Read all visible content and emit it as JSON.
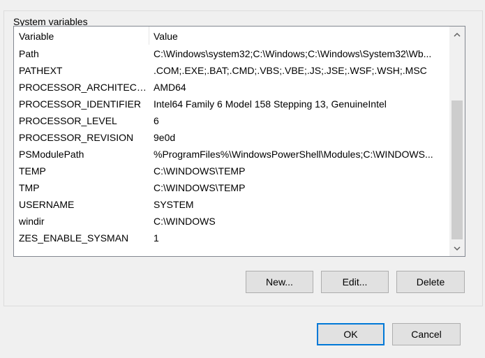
{
  "group": {
    "title": "System variables"
  },
  "table": {
    "columns": [
      "Variable",
      "Value"
    ],
    "rows": [
      {
        "variable": "Path",
        "value": "C:\\Windows\\system32;C:\\Windows;C:\\Windows\\System32\\Wb..."
      },
      {
        "variable": "PATHEXT",
        "value": ".COM;.EXE;.BAT;.CMD;.VBS;.VBE;.JS;.JSE;.WSF;.WSH;.MSC"
      },
      {
        "variable": "PROCESSOR_ARCHITECTU...",
        "value": "AMD64"
      },
      {
        "variable": "PROCESSOR_IDENTIFIER",
        "value": "Intel64 Family 6 Model 158 Stepping 13, GenuineIntel"
      },
      {
        "variable": "PROCESSOR_LEVEL",
        "value": "6"
      },
      {
        "variable": "PROCESSOR_REVISION",
        "value": "9e0d"
      },
      {
        "variable": "PSModulePath",
        "value": "%ProgramFiles%\\WindowsPowerShell\\Modules;C:\\WINDOWS..."
      },
      {
        "variable": "TEMP",
        "value": "C:\\WINDOWS\\TEMP"
      },
      {
        "variable": "TMP",
        "value": "C:\\WINDOWS\\TEMP"
      },
      {
        "variable": "USERNAME",
        "value": "SYSTEM"
      },
      {
        "variable": "windir",
        "value": "C:\\WINDOWS"
      },
      {
        "variable": "ZES_ENABLE_SYSMAN",
        "value": "1"
      }
    ]
  },
  "buttons": {
    "new": "New...",
    "edit": "Edit...",
    "delete": "Delete",
    "ok": "OK",
    "cancel": "Cancel"
  },
  "icons": {
    "scroll_up": "chevron-up-icon",
    "scroll_down": "chevron-down-icon"
  },
  "colors": {
    "default_button_border": "#0078d7",
    "button_face": "#e1e1e1"
  }
}
